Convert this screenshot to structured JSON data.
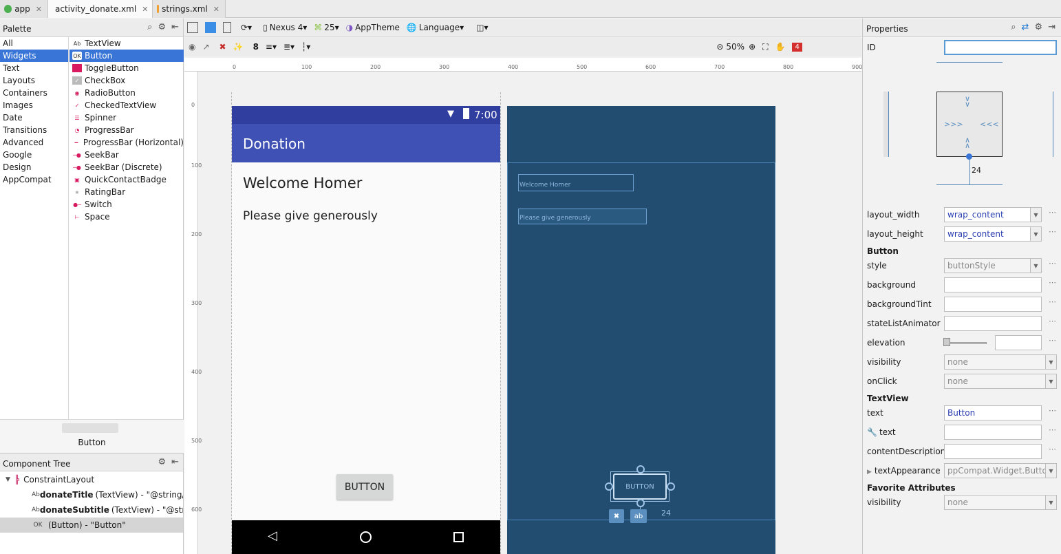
{
  "tabs": [
    {
      "label": "app",
      "close": "✕"
    },
    {
      "label": "activity_donate.xml",
      "close": "✕"
    },
    {
      "label": "strings.xml",
      "close": "✕"
    }
  ],
  "palette": {
    "title": "Palette",
    "categories": [
      "All",
      "Widgets",
      "Text",
      "Layouts",
      "Containers",
      "Images",
      "Date",
      "Transitions",
      "Advanced",
      "Google",
      "Design",
      "AppCompat"
    ],
    "widgets": [
      "TextView",
      "Button",
      "ToggleButton",
      "CheckBox",
      "RadioButton",
      "CheckedTextView",
      "Spinner",
      "ProgressBar",
      "ProgressBar (Horizontal)",
      "SeekBar",
      "SeekBar (Discrete)",
      "QuickContactBadge",
      "RatingBar",
      "Switch",
      "Space"
    ],
    "preview_label": "Button"
  },
  "tree": {
    "title": "Component Tree",
    "root": "ConstraintLayout",
    "items": [
      {
        "icon": "Ab",
        "id": "donateTitle",
        "rest": "(TextView) - \"@string/donate_title\""
      },
      {
        "icon": "Ab",
        "id": "donateSubtitle",
        "rest": "(TextView) - \"@string/donate_subtitle\""
      },
      {
        "icon": "OK",
        "id": "",
        "rest": "(Button) - \"Button\""
      }
    ]
  },
  "toolbar": {
    "device": "Nexus 4",
    "api": "25",
    "theme": "AppTheme",
    "language": "Language",
    "margin": "8",
    "zoom": "50%",
    "warnings": "4"
  },
  "ruler": {
    "h": [
      "0",
      "100",
      "200",
      "300",
      "400",
      "500",
      "600",
      "700",
      "800",
      "900"
    ],
    "v": [
      "0",
      "100",
      "200",
      "300",
      "400",
      "500",
      "600"
    ]
  },
  "design": {
    "time": "7:00",
    "app_title": "Donation",
    "title": "Welcome Homer",
    "subtitle": "Please give generously",
    "button": "BUTTON"
  },
  "blueprint": {
    "title": "Welcome Homer",
    "subtitle": "Please give generously",
    "button": "BUTTON",
    "margin": "24"
  },
  "properties": {
    "title": "Properties",
    "id_label": "ID",
    "id_value": "",
    "inspector_margin": "24",
    "rows1": [
      {
        "label": "layout_width",
        "value": "wrap_content"
      },
      {
        "label": "layout_height",
        "value": "wrap_content"
      }
    ],
    "section_button": "Button",
    "rows2": [
      {
        "label": "style",
        "value": "buttonStyle"
      },
      {
        "label": "background",
        "value": ""
      },
      {
        "label": "backgroundTint",
        "value": ""
      },
      {
        "label": "stateListAnimator",
        "value": ""
      },
      {
        "label": "elevation",
        "value": ""
      },
      {
        "label": "visibility",
        "value": "none"
      },
      {
        "label": "onClick",
        "value": "none"
      }
    ],
    "section_textview": "TextView",
    "rows3": [
      {
        "label": "text",
        "value": "Button"
      },
      {
        "label": "text",
        "value": ""
      },
      {
        "label": "contentDescription",
        "value": ""
      },
      {
        "label": "textAppearance",
        "value": "ppCompat.Widget.Button"
      }
    ],
    "section_fav": "Favorite Attributes",
    "rows4": [
      {
        "label": "visibility",
        "value": "none"
      }
    ]
  }
}
